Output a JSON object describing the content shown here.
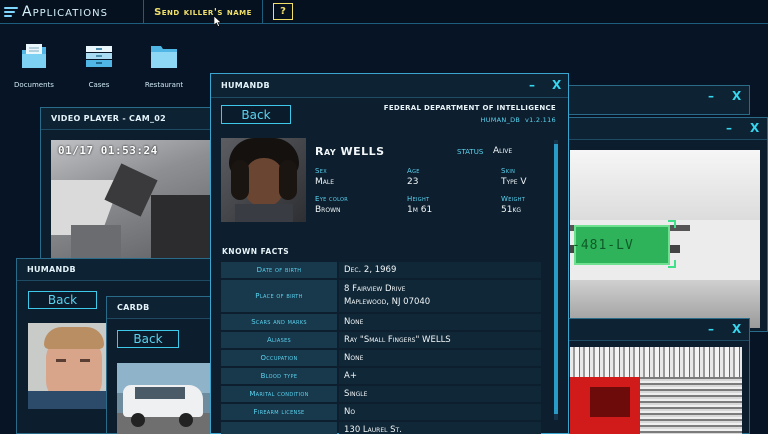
{
  "topbar": {
    "apps_label": "Applications",
    "tab_label": "Send killer's name",
    "help_label": "?"
  },
  "desktop": {
    "icons": [
      {
        "label": "Documents",
        "icon": "documents-icon"
      },
      {
        "label": "Cases",
        "icon": "cases-icon"
      },
      {
        "label": "Restaurant",
        "icon": "folder-icon"
      }
    ]
  },
  "window_controls": {
    "minimize": "–",
    "close": "X"
  },
  "video_player": {
    "title": "VIDEO PLAYER - CAM_02",
    "timestamp": "01/17 01:53:24"
  },
  "humandb_main": {
    "title": "HUMANDB",
    "back_label": "Back",
    "agency": "FEDERAL DEPARTMENT OF INTELLIGENCE",
    "db": "HUMAN_DB",
    "version": "v1.2.116",
    "name": "Ray WELLS",
    "status_label": "STATUS",
    "status_value": "Alive",
    "attributes": {
      "sex_label": "Sex",
      "sex": "Male",
      "age_label": "Age",
      "age": "23",
      "skin_label": "Skin",
      "skin": "Type V",
      "eye_label": "Eye color",
      "eye": "Brown",
      "height_label": "Height",
      "height": "1m 61",
      "weight_label": "Weight",
      "weight": "51kg"
    },
    "known_facts_title": "KNOWN FACTS",
    "facts": [
      {
        "label": "Date of birth",
        "value": "Dec. 2, 1969"
      },
      {
        "label": "Place of birth",
        "value": "8 Fairview Drive",
        "value2": "Maplewood, NJ 07040"
      },
      {
        "label": "Scars and marks",
        "value": "None"
      },
      {
        "label": "Aliases",
        "value": "Ray \"Small Fingers\" WELLS"
      },
      {
        "label": "Occupation",
        "value": "None"
      },
      {
        "label": "Blood type",
        "value": "A+"
      },
      {
        "label": "Marital condition",
        "value": "Single"
      },
      {
        "label": "Firearm license",
        "value": "No"
      },
      {
        "label": "",
        "value": "130 Laurel St."
      }
    ]
  },
  "humandb_second": {
    "title": "HUMANDB",
    "back_label": "Back"
  },
  "cardb": {
    "title": "CARDB",
    "back_label": "Back"
  },
  "plate_readout": "-481-LV",
  "colors": {
    "accent": "#3fc9e8",
    "highlight": "#f0e06a",
    "window_bg": "#0c1e2e",
    "desktop_bg": "#071426"
  }
}
